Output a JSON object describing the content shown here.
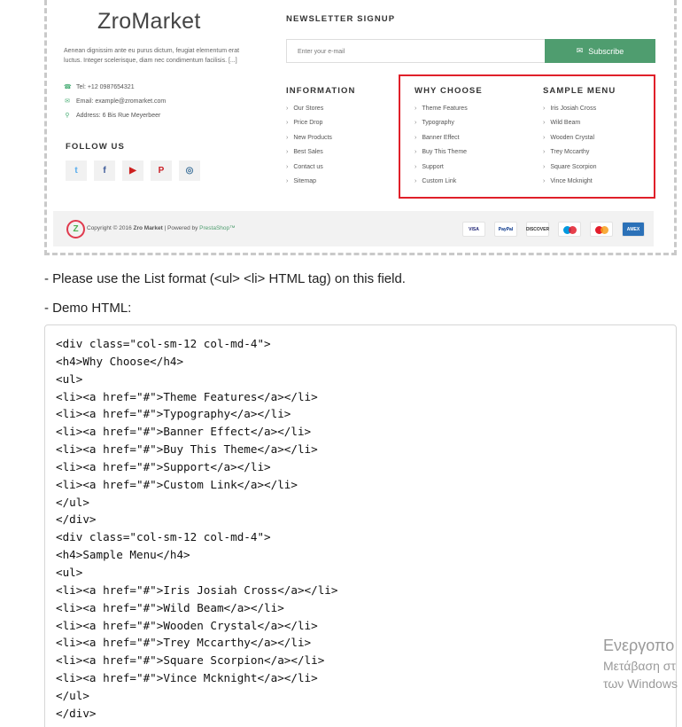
{
  "footer": {
    "logo": "ZroMarket",
    "about": "Aenean dignissim ante eu purus dictum, feugiat elementum erat luctus. Integer scelerisque, diam nec condimentum facilisis. [...]",
    "contact": {
      "tel": "Tel: +12 0987654321",
      "email": "Email: example@zromarket.com",
      "address": "Address: 6 Bis Rue Meyerbeer"
    },
    "follow_heading": "FOLLOW US",
    "newsletter": {
      "heading": "NEWSLETTER SIGNUP",
      "placeholder": "Enter your e-mail",
      "button": "Subscribe"
    },
    "information": {
      "heading": "INFORMATION",
      "items": [
        "Our Stores",
        "Price Drop",
        "New Products",
        "Best Sales",
        "Contact us",
        "Sitemap"
      ]
    },
    "why_choose": {
      "heading": "WHY CHOOSE",
      "items": [
        "Theme Features",
        "Typography",
        "Banner Effect",
        "Buy This Theme",
        "Support",
        "Custom Link"
      ]
    },
    "sample_menu": {
      "heading": "SAMPLE MENU",
      "items": [
        "Iris Josiah Cross",
        "Wild Beam",
        "Wooden Crystal",
        "Trey Mccarthy",
        "Square Scorpion",
        "Vince Mcknight"
      ]
    },
    "copyright": {
      "prefix": "Copyright © 2016 ",
      "brand": "Zro Market",
      "sep": " | Powered by ",
      "platform": "PrestaShop™"
    },
    "payments": [
      "VISA",
      "PayPal",
      "DISCOVER",
      "maestro",
      "mastercard",
      "AMEX"
    ]
  },
  "instructions": {
    "line1": "- Please use the List format (<ul> <li> HTML tag) on this field.",
    "line2": "- Demo HTML:"
  },
  "code_lines": [
    "<div class=\"col-sm-12 col-md-4\">",
    "<h4>Why Choose</h4>",
    "<ul>",
    "<li><a href=\"#\">Theme Features</a></li>",
    "<li><a href=\"#\">Typography</a></li>",
    "<li><a href=\"#\">Banner Effect</a></li>",
    "<li><a href=\"#\">Buy This Theme</a></li>",
    "<li><a href=\"#\">Support</a></li>",
    "<li><a href=\"#\">Custom Link</a></li>",
    "</ul>",
    "</div>",
    "<div class=\"col-sm-12 col-md-4\">",
    "<h4>Sample Menu</h4>",
    "<ul>",
    "<li><a href=\"#\">Iris Josiah Cross</a></li>",
    "<li><a href=\"#\">Wild Beam</a></li>",
    "<li><a href=\"#\">Wooden Crystal</a></li>",
    "<li><a href=\"#\">Trey Mccarthy</a></li>",
    "<li><a href=\"#\">Square Scorpion</a></li>",
    "<li><a href=\"#\">Vince Mcknight</a></li>",
    "</ul>",
    "</div>"
  ],
  "watermark": {
    "line1": "Ενεργοπο",
    "line2": "Μετάβαση στ",
    "line3": "των Windows"
  },
  "colors": {
    "accent_green": "#4f9d6f",
    "highlight_red": "#e0202a"
  }
}
